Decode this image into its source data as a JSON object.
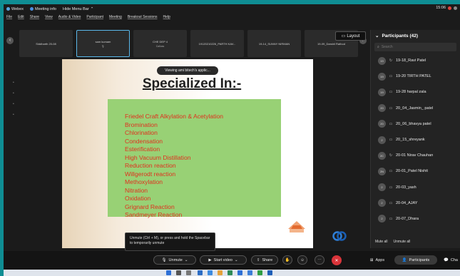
{
  "titlebar": {
    "app": "Webex",
    "meeting_info": "Meeting info",
    "hide_menu": "Hide Menu Bar",
    "time": "15:06"
  },
  "menubar": [
    "File",
    "Edit",
    "Share",
    "View",
    "Audio & Video",
    "Participant",
    "Meeting",
    "Breakout Sessions",
    "Help"
  ],
  "thumbnails": [
    {
      "name": "Siddharth 20-08",
      "sub": ""
    },
    {
      "name": "sam kumam",
      "sub": ""
    },
    {
      "name": "CHE DEP 4",
      "sub": "Calluss"
    },
    {
      "name": "19120210226_PARTH KAV...",
      "sub": ""
    },
    {
      "name": "19-14_SUNNY NIRMAN",
      "sub": ""
    },
    {
      "name": "19-09_Darshil Rathod",
      "sub": ""
    }
  ],
  "layout_label": "Layout",
  "viewing_label": "Viewing ami bitech's applic...",
  "slide": {
    "title": "Specialized In:-",
    "topics": [
      "Friedel Craft Alkylation & Acetylation",
      "Bromination",
      "Chlorination",
      "Condensation",
      "Esterification",
      "High Vacuum Distillation",
      "Reduction reaction",
      "Willgerodt reaction",
      "Methoxylation",
      "Nitration",
      "Oxidation",
      "Grignard Reaction",
      "Sandmeyer Reaction"
    ]
  },
  "unmute_tip": "Unmute (Ctrl + M), or press and hold the Spacebar to temporarily unmute",
  "participants": {
    "header": "Participants (42)",
    "search_placeholder": "Search",
    "list": [
      {
        "initials": "19",
        "icon": "↻",
        "name": "19-18_Ravi Patel"
      },
      {
        "initials": "19",
        "icon": "▭",
        "name": "19-20 TIRTH PATEL"
      },
      {
        "initials": "19",
        "icon": "▭",
        "name": "19-28 harpal zala"
      },
      {
        "initials": "20",
        "icon": "▭",
        "name": "20_04_Jasmin_ patel"
      },
      {
        "initials": "20",
        "icon": "▭",
        "name": "20_06_bhavya patel"
      },
      {
        "initials": "2",
        "icon": "▭",
        "name": "20_15_shreyank"
      },
      {
        "initials": "2C",
        "icon": "↻",
        "name": "20-01 Nirav Chauhan"
      },
      {
        "initials": "2N",
        "icon": "▭",
        "name": "20-01_Patel Nishit"
      },
      {
        "initials": "2",
        "icon": "▭",
        "name": "20-03_yash"
      },
      {
        "initials": "2",
        "icon": "▭",
        "name": "20-04_AJAY"
      },
      {
        "initials": "2",
        "icon": "▭",
        "name": "20-07_Dhara"
      }
    ],
    "mute_all": "Mute all",
    "unmute_all": "Unmute all"
  },
  "toolbar": {
    "unmute": "Unmute",
    "start_video": "Start video",
    "share": "Share",
    "apps": "Apps",
    "participants": "Participants",
    "chat": "Cha"
  }
}
